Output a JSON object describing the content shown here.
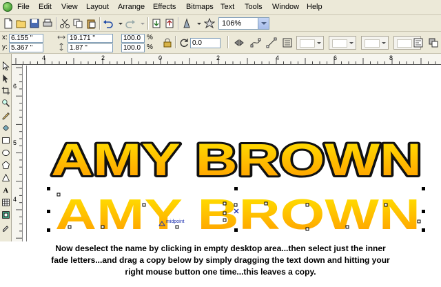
{
  "menu": {
    "items": [
      "File",
      "Edit",
      "View",
      "Layout",
      "Arrange",
      "Effects",
      "Bitmaps",
      "Text",
      "Tools",
      "Window",
      "Help"
    ]
  },
  "toolbar": {
    "zoom_value": "106%"
  },
  "property_bar": {
    "x_label": "x:",
    "y_label": "y:",
    "x_value": "6.155 \"",
    "y_value": "5.367 \"",
    "width_value": "19.171 \"",
    "height_value": "1.87 \"",
    "scale_x": "100.0",
    "scale_y": "100.0",
    "scale_unit_x": "%",
    "scale_unit_y": "%",
    "rotation_value": "0.0"
  },
  "ruler": {
    "h_labels": [
      "4",
      "2",
      "0",
      "2",
      "4",
      "6",
      "8",
      "10",
      "12",
      "14",
      "16"
    ],
    "v_labels": [
      "6",
      "5",
      "4",
      "3"
    ]
  },
  "canvas": {
    "original_text": "AMY BROWN",
    "copy_text": "AMY BROWN",
    "midpoint_label": "midpoint"
  },
  "caption": {
    "line1": "Now deselect the name by clicking in empty desktop area...then select just the inner",
    "line2": "fade letters...and drag a copy below by simply dragging the text down and hitting your",
    "line3": "right mouse button one time...this leaves a copy."
  },
  "colors": {
    "ui_face": "#ece9d8",
    "fade_top": "#ffe600",
    "fade_bottom": "#ff9a00",
    "outline": "#111111",
    "midpoint": "#1b2fb0"
  }
}
